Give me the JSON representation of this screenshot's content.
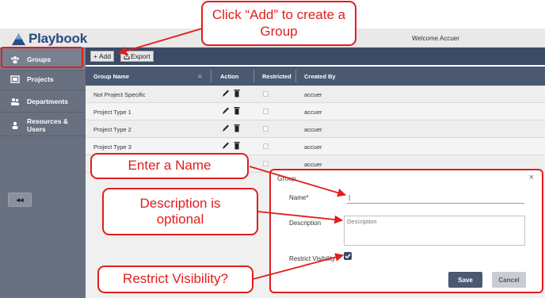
{
  "app": {
    "logo_text": "Playbook",
    "welcome_text": "Welcome Accuer"
  },
  "sidebar": {
    "items": [
      {
        "label": "Groups",
        "icon": "groups-icon",
        "active": true
      },
      {
        "label": "Projects",
        "icon": "projects-icon",
        "active": false
      },
      {
        "label": "Departments",
        "icon": "departments-icon",
        "active": false
      },
      {
        "label": "Resources & Users",
        "icon": "user-icon",
        "active": false
      }
    ],
    "collapse_label": "◂◂"
  },
  "toolbar": {
    "add_label": "+ Add",
    "export_label": "Export"
  },
  "grid": {
    "columns": [
      "Group Name",
      "Action",
      "Restricted",
      "Created By"
    ],
    "column_menu_glyph": "≡",
    "rows": [
      {
        "name": "Not Project Specific",
        "restricted": false,
        "created_by": "accuer"
      },
      {
        "name": "Project Type 1",
        "restricted": false,
        "created_by": "accuer"
      },
      {
        "name": "Project Type 2",
        "restricted": false,
        "created_by": "accuer"
      },
      {
        "name": "Project Type 3",
        "restricted": false,
        "created_by": "accuer"
      },
      {
        "name": "",
        "restricted": false,
        "created_by": "accuer"
      }
    ]
  },
  "modal": {
    "title": "Group",
    "close_glyph": "×",
    "name_label": "Name*",
    "name_value": "|",
    "description_label": "Description",
    "description_placeholder": "Description",
    "restrict_label": "Restrict Visibility",
    "restrict_checked": true,
    "save_label": "Save",
    "cancel_label": "Cancel"
  },
  "callouts": {
    "add": "Click “Add” to create a Group",
    "name": "Enter a Name",
    "description": "Description is optional",
    "restrict": "Restrict Visibility?"
  },
  "colors": {
    "callout_red": "#e21d1d",
    "toolbar": "#3b4a65",
    "sidebar": "#697080",
    "brand": "#2a4b7e"
  }
}
